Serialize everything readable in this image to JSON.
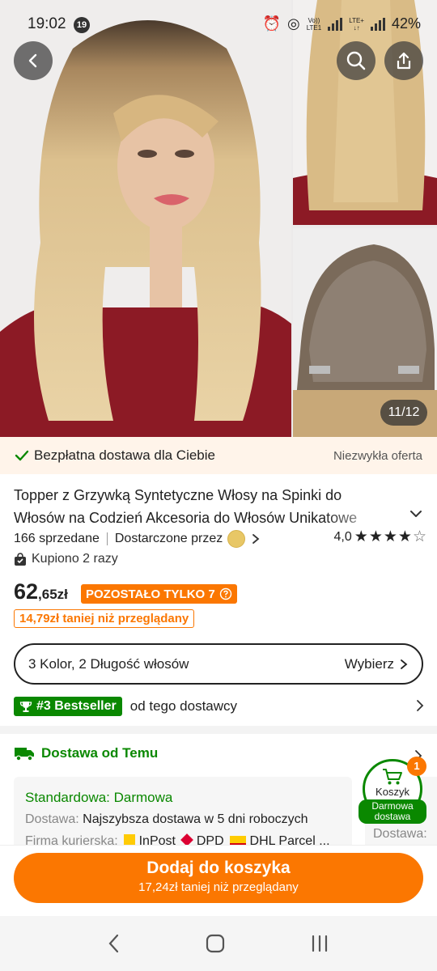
{
  "status_bar": {
    "time": "19:02",
    "notification_count": "19",
    "network_top": "Vo))",
    "network_bottom": "LTE1",
    "lte_top": "LTE+",
    "lte_bottom": "↓↑",
    "battery": "42%"
  },
  "gallery": {
    "counter": "11/12"
  },
  "shipping_banner": {
    "text": "Bezpłatna dostawa dla Ciebie",
    "offer": "Niezwykła oferta"
  },
  "product": {
    "title": "Topper z Grzywką Syntetyczne Włosy na Spinki do Włosów na Codzień Akcesoria do Włosów Unikatowe",
    "sold": "166 sprzedane",
    "supplier_label": "Dostarczone przez",
    "rating": "4,0",
    "rating_value": 4,
    "bought": "Kupiono 2 razy",
    "price_main": "62",
    "price_fraction": ",65zł",
    "stock_badge": "POZOSTAŁO TYLKO 7",
    "cheaper": "14,79zł taniej niż przeglądany"
  },
  "variant": {
    "summary": "3 Kolor, 2 Długość włosów",
    "action": "Wybierz"
  },
  "bestseller": {
    "badge": "#3 Bestseller",
    "text": "od tego dostawcy"
  },
  "delivery": {
    "heading": "Dostawa od Temu",
    "standard": "Standardowa: Darmowa",
    "delivery_label": "Dostawa:",
    "delivery_value": "Najszybsza dostawa w 5 dni roboczych",
    "couriers_label": "Firma kurierska:",
    "couriers": [
      "InPost",
      "DPD",
      "DHL Parcel ..."
    ],
    "card2_label": "Dostawa: "
  },
  "cart": {
    "label": "Koszyk",
    "count": "1",
    "free": "Darmowa dostawa"
  },
  "cta": {
    "label": "Dodaj do koszyka",
    "sub": "17,24zł taniej niż przeglądany"
  },
  "colors": {
    "accent": "#fb7701",
    "green": "#0a8800"
  }
}
